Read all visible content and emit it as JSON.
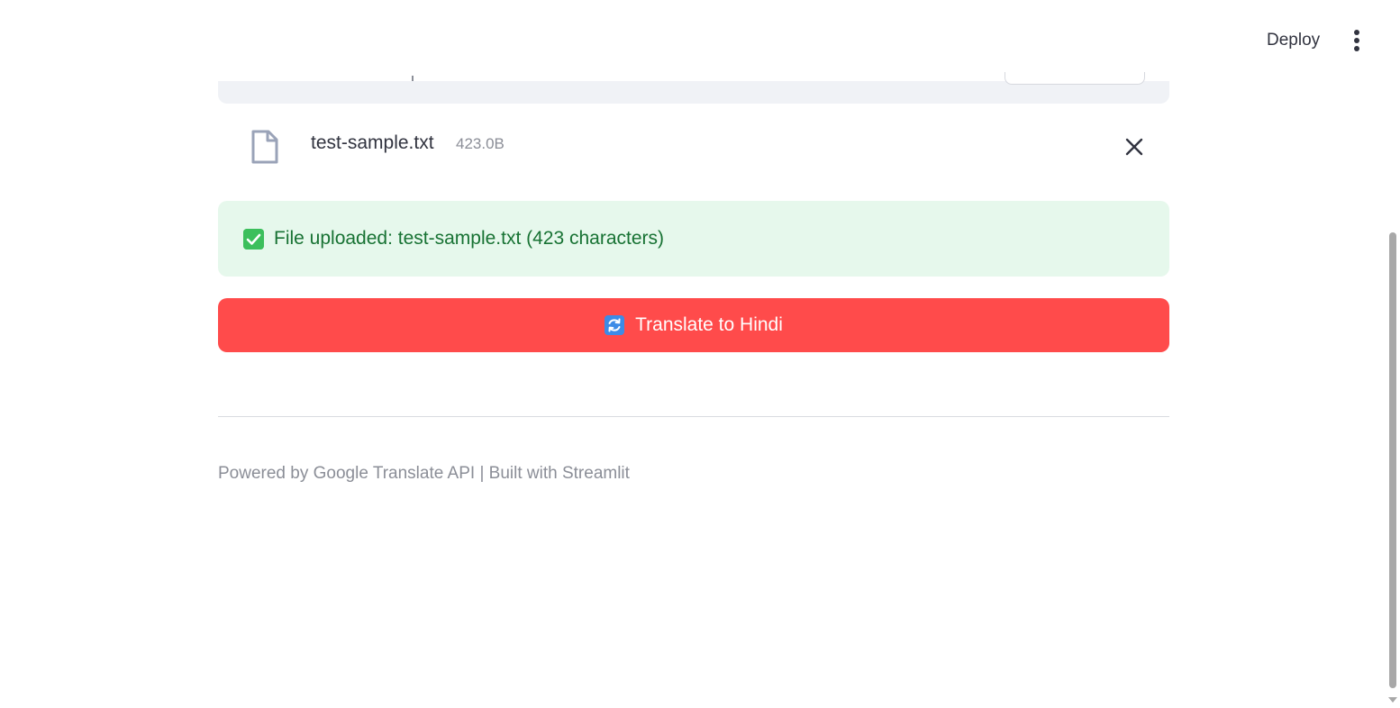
{
  "header": {
    "deploy_label": "Deploy",
    "menu_icon": "more-vertical-icon"
  },
  "uploader": {
    "file": {
      "icon": "file-icon",
      "name": "test-sample.txt",
      "size": "423.0B",
      "remove_icon": "close-icon"
    }
  },
  "alert": {
    "icon": "check-box-icon",
    "text": "File uploaded: test-sample.txt (423 characters)",
    "color": "#177233",
    "background": "#e6f8ec"
  },
  "translate_button": {
    "icon": "arrows-counterclockwise-icon",
    "label": "Translate to Hindi",
    "color": "#ff4b4b"
  },
  "footer": {
    "text": "Powered by Google Translate API | Built with Streamlit"
  }
}
